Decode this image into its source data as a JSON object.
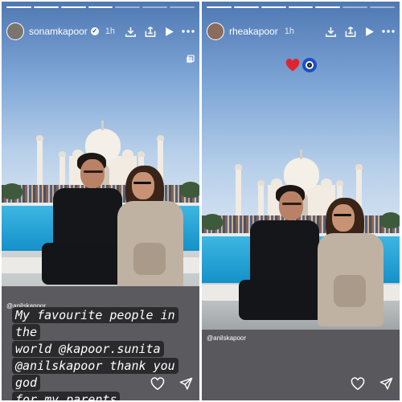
{
  "stories": [
    {
      "username": "sonamkapoor",
      "time": "1h",
      "tag": "@anilskapoor",
      "caption_lines": [
        "My favourite people in the",
        "world @kapoor.sunita",
        "@anilskapoor thank you god",
        "for my parents"
      ]
    },
    {
      "username": "rheakapoor",
      "time": "1h",
      "tag": "@anilskapoor",
      "emojis": [
        "heart-emoji",
        "evil-eye-emoji"
      ]
    }
  ],
  "icons": [
    "download-icon",
    "save-to-collection-icon",
    "play-icon",
    "more-icon",
    "carousel-icon",
    "heart-icon",
    "share-icon",
    "verified-icon"
  ],
  "colors": {
    "caption_bg": "#2a2a2c",
    "sky": "#6d95c8",
    "pool": "#1fa3d6",
    "heart": "#e0242f",
    "evil_eye": "#1c4fc2"
  }
}
